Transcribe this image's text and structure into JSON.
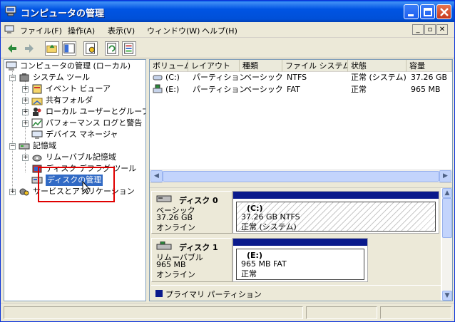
{
  "window": {
    "title": "コンピュータの管理"
  },
  "menu": {
    "items": [
      "ファイル(F)",
      "操作(A)",
      "表示(V)",
      "ウィンドウ(W)",
      "ヘルプ(H)"
    ],
    "mdi": [
      "_",
      "▫",
      "✕"
    ]
  },
  "tree": {
    "root": "コンピュータの管理 (ローカル)",
    "system_tools": "システム ツール",
    "event_viewer": "イベント ビューア",
    "shared_folders": "共有フォルダ",
    "local_users": "ローカル ユーザーとグループ",
    "perf_logs": "パフォーマンス ログと警告",
    "device_manager": "デバイス マネージャ",
    "storage": "記憶域",
    "removable_storage": "リムーバブル記憶域",
    "defrag": "ディスク デフラグ ツール",
    "disk_mgmt": "ディスクの管理",
    "services_apps": "サービスとアプリケーション"
  },
  "volumes": {
    "columns": [
      "ボリューム",
      "レイアウト",
      "種類",
      "ファイル システム",
      "状態",
      "容量"
    ],
    "rows": [
      {
        "volume": "(C:)",
        "layout": "パーティション",
        "type": "ベーシック",
        "fs": "NTFS",
        "status": "正常 (システム)",
        "capacity": "37.26 GB"
      },
      {
        "volume": "(E:)",
        "layout": "パーティション",
        "type": "ベーシック",
        "fs": "FAT",
        "status": "正常",
        "capacity": "965 MB"
      }
    ]
  },
  "disks": [
    {
      "name": "ディスク 0",
      "type": "ベーシック",
      "size": "37.26 GB",
      "state": "オンライン",
      "partition": {
        "label": "(C:)",
        "detail": "37.26 GB NTFS",
        "status": "正常 (システム)"
      }
    },
    {
      "name": "ディスク 1",
      "type": "リムーバブル",
      "size": "965 MB",
      "state": "オンライン",
      "partition": {
        "label": "(E:)",
        "detail": "965 MB FAT",
        "status": "正常"
      }
    }
  ],
  "legend": {
    "primary": "プライマリ パーティション"
  },
  "colors": {
    "titlebar": "#0054e3",
    "partition_bar": "#0a1a8c",
    "selection": "#316ac5",
    "highlight_box": "#e00000"
  }
}
